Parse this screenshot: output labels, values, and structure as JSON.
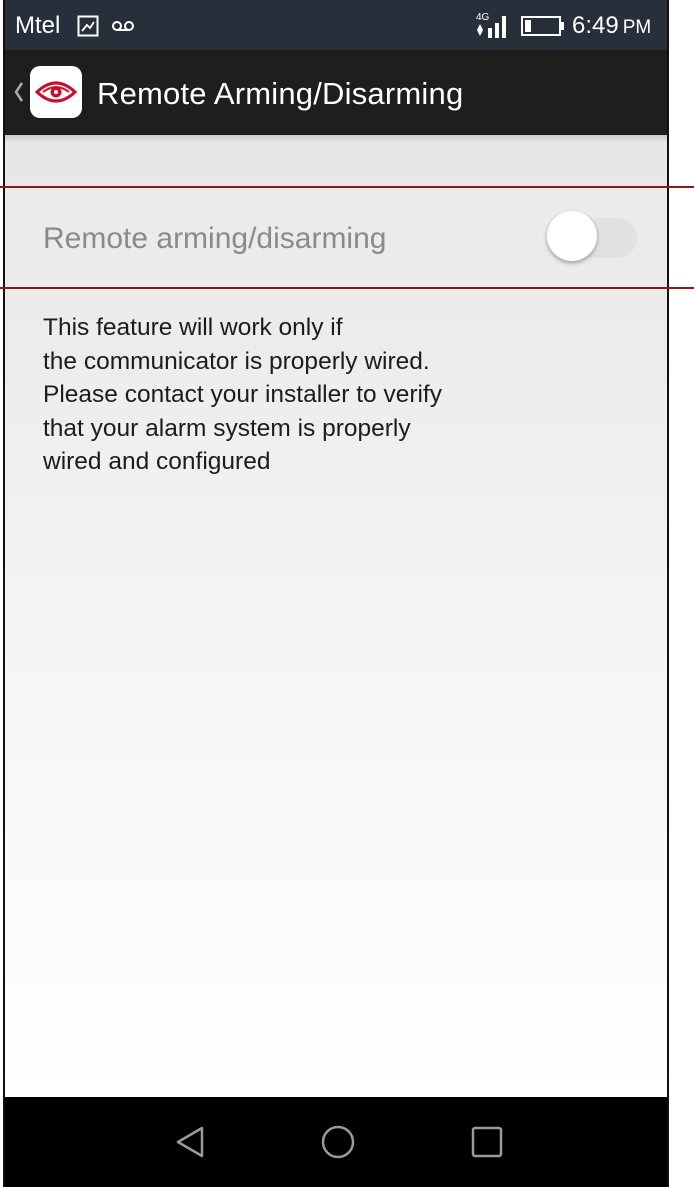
{
  "status_bar": {
    "carrier": "Mtel",
    "network": "4G",
    "time": "6:49",
    "ampm": "PM",
    "icons": [
      "sim-icon",
      "voicemail-icon",
      "signal-icon",
      "battery-icon"
    ]
  },
  "action_bar": {
    "title": "Remote Arming/Disarming",
    "icons": [
      "back-chevron-icon",
      "app-logo-icon"
    ]
  },
  "settings": {
    "remote_arming_label": "Remote arming/disarming",
    "remote_arming_enabled": false
  },
  "note": {
    "lines": [
      "This feature will work only if",
      "the communicator is properly wired.",
      "Please contact your installer to verify",
      "that your alarm system is properly",
      "wired and configured"
    ]
  },
  "nav_bar": {
    "icons": [
      "back-triangle-icon",
      "home-circle-icon",
      "recents-square-icon"
    ]
  },
  "colors": {
    "status_bar_bg": "#27303a",
    "action_bar_bg": "#1e1e1e",
    "highlight_line": "#8b1a1a",
    "logo_red": "#c8102e"
  }
}
